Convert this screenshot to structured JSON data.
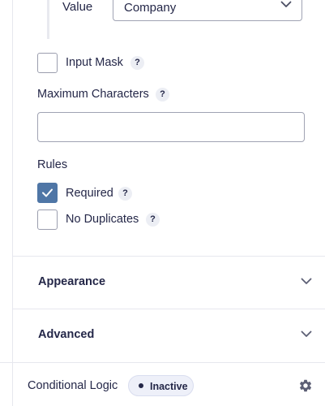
{
  "value_row": {
    "label": "Value",
    "selected": "Company"
  },
  "input_mask": {
    "label": "Input Mask",
    "help": "?",
    "checked": false
  },
  "max_chars": {
    "label": "Maximum Characters",
    "help": "?",
    "value": ""
  },
  "rules": {
    "heading": "Rules",
    "items": [
      {
        "label": "Required",
        "help": "?",
        "checked": true
      },
      {
        "label": "No Duplicates",
        "help": "?",
        "checked": false
      }
    ]
  },
  "sections": [
    {
      "title": "Appearance"
    },
    {
      "title": "Advanced"
    }
  ],
  "conditional_logic": {
    "label": "Conditional Logic",
    "status": "Inactive"
  },
  "icons": {
    "chevron": "chevron-down-icon",
    "help": "help-icon",
    "settings": "gear-icon",
    "check": "check-icon"
  },
  "colors": {
    "checked": "#4f76a6",
    "text": "#242748",
    "border": "#a0a3b3",
    "pill_bg": "#eef0f9"
  }
}
